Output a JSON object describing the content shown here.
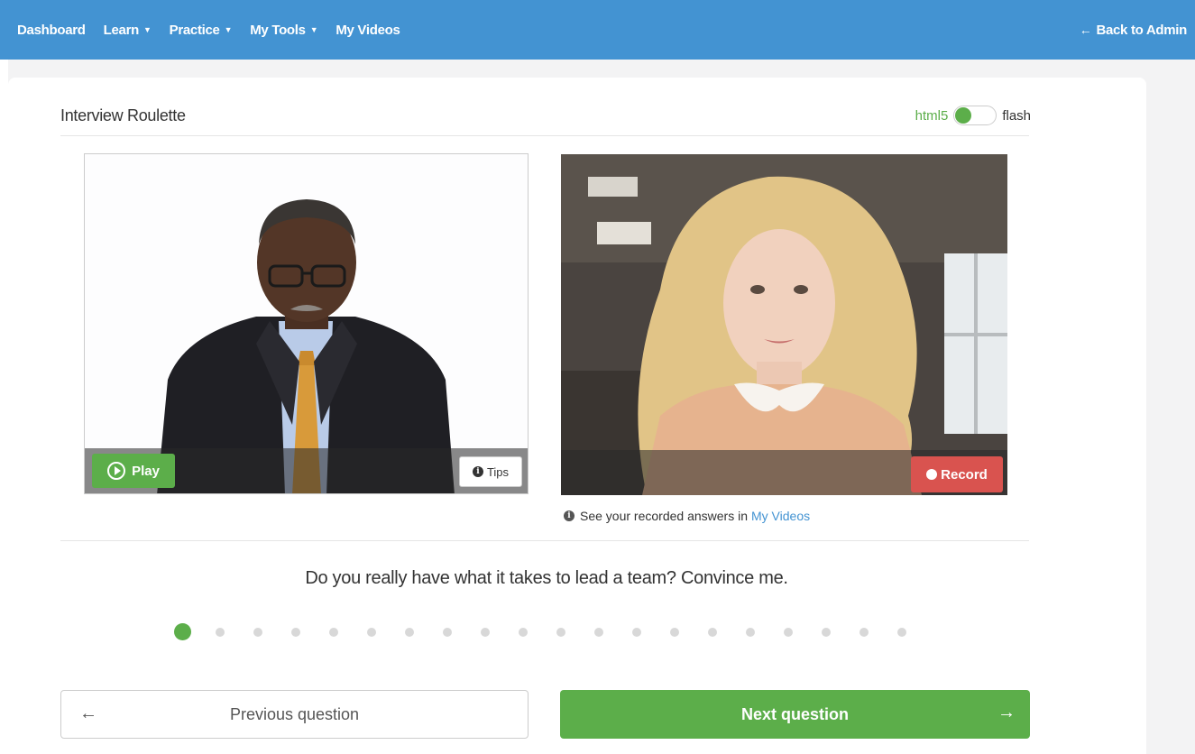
{
  "nav": {
    "items": [
      {
        "label": "Dashboard",
        "dropdown": false
      },
      {
        "label": "Learn",
        "dropdown": true
      },
      {
        "label": "Practice",
        "dropdown": true
      },
      {
        "label": "My Tools",
        "dropdown": true
      },
      {
        "label": "My Videos",
        "dropdown": false
      }
    ],
    "back_label": "Back to Admin"
  },
  "page": {
    "title": "Interview Roulette",
    "toggle": {
      "left_label": "html5",
      "right_label": "flash",
      "selected": "html5"
    }
  },
  "interviewer_video": {
    "play_label": "Play",
    "tips_label": "Tips"
  },
  "webcam_video": {
    "record_label": "Record"
  },
  "recorded_note": {
    "text": "See your recorded answers in",
    "link_label": "My Videos"
  },
  "question": {
    "text": "Do you really have what it takes to lead a team? Convince me.",
    "current_index": 1,
    "total": 20
  },
  "buttons": {
    "previous_label": "Previous question",
    "next_label": "Next question"
  },
  "colors": {
    "nav_bg": "#4393d2",
    "primary_green": "#5cae4a",
    "record_red": "#d9534f",
    "link_blue": "#4393d2"
  }
}
